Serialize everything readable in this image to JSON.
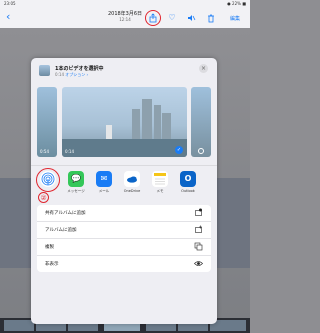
{
  "status": {
    "time": "23:05",
    "battery": "● 22% ■"
  },
  "nav": {
    "back": "‹",
    "date": "2018年3月6日",
    "time": "12:14",
    "edit_label": "編集",
    "icons": [
      "share-icon",
      "heart-icon",
      "mute-icon",
      "trash-icon"
    ]
  },
  "markers": {
    "one": "①",
    "two": "②"
  },
  "sheet": {
    "title": "1本のビデオを選択中",
    "subtitle_time": "0:14",
    "options_label": "オプション ›",
    "close": "×",
    "preview_durations": [
      "0:54",
      "0:14"
    ],
    "apps": [
      {
        "label": "",
        "icon": "airdrop-icon",
        "color": "#ffffff"
      },
      {
        "label": "メッセージ",
        "icon": "messages-icon",
        "color": "#34c759"
      },
      {
        "label": "メール",
        "icon": "mail-icon",
        "color": "#1a7cf5"
      },
      {
        "label": "OneDrive",
        "icon": "onedrive-icon",
        "color": "#ffffff"
      },
      {
        "label": "メモ",
        "icon": "notes-icon",
        "color": "#ffffff"
      },
      {
        "label": "Outlook",
        "icon": "outlook-icon",
        "color": "#0a64c8"
      }
    ],
    "actions": [
      {
        "label": "共有アルバムに追加",
        "icon": "shared-album-icon"
      },
      {
        "label": "アルバムに追加",
        "icon": "add-album-icon"
      },
      {
        "label": "複製",
        "icon": "duplicate-icon"
      },
      {
        "label": "非表示",
        "icon": "hide-eye-icon"
      }
    ]
  }
}
